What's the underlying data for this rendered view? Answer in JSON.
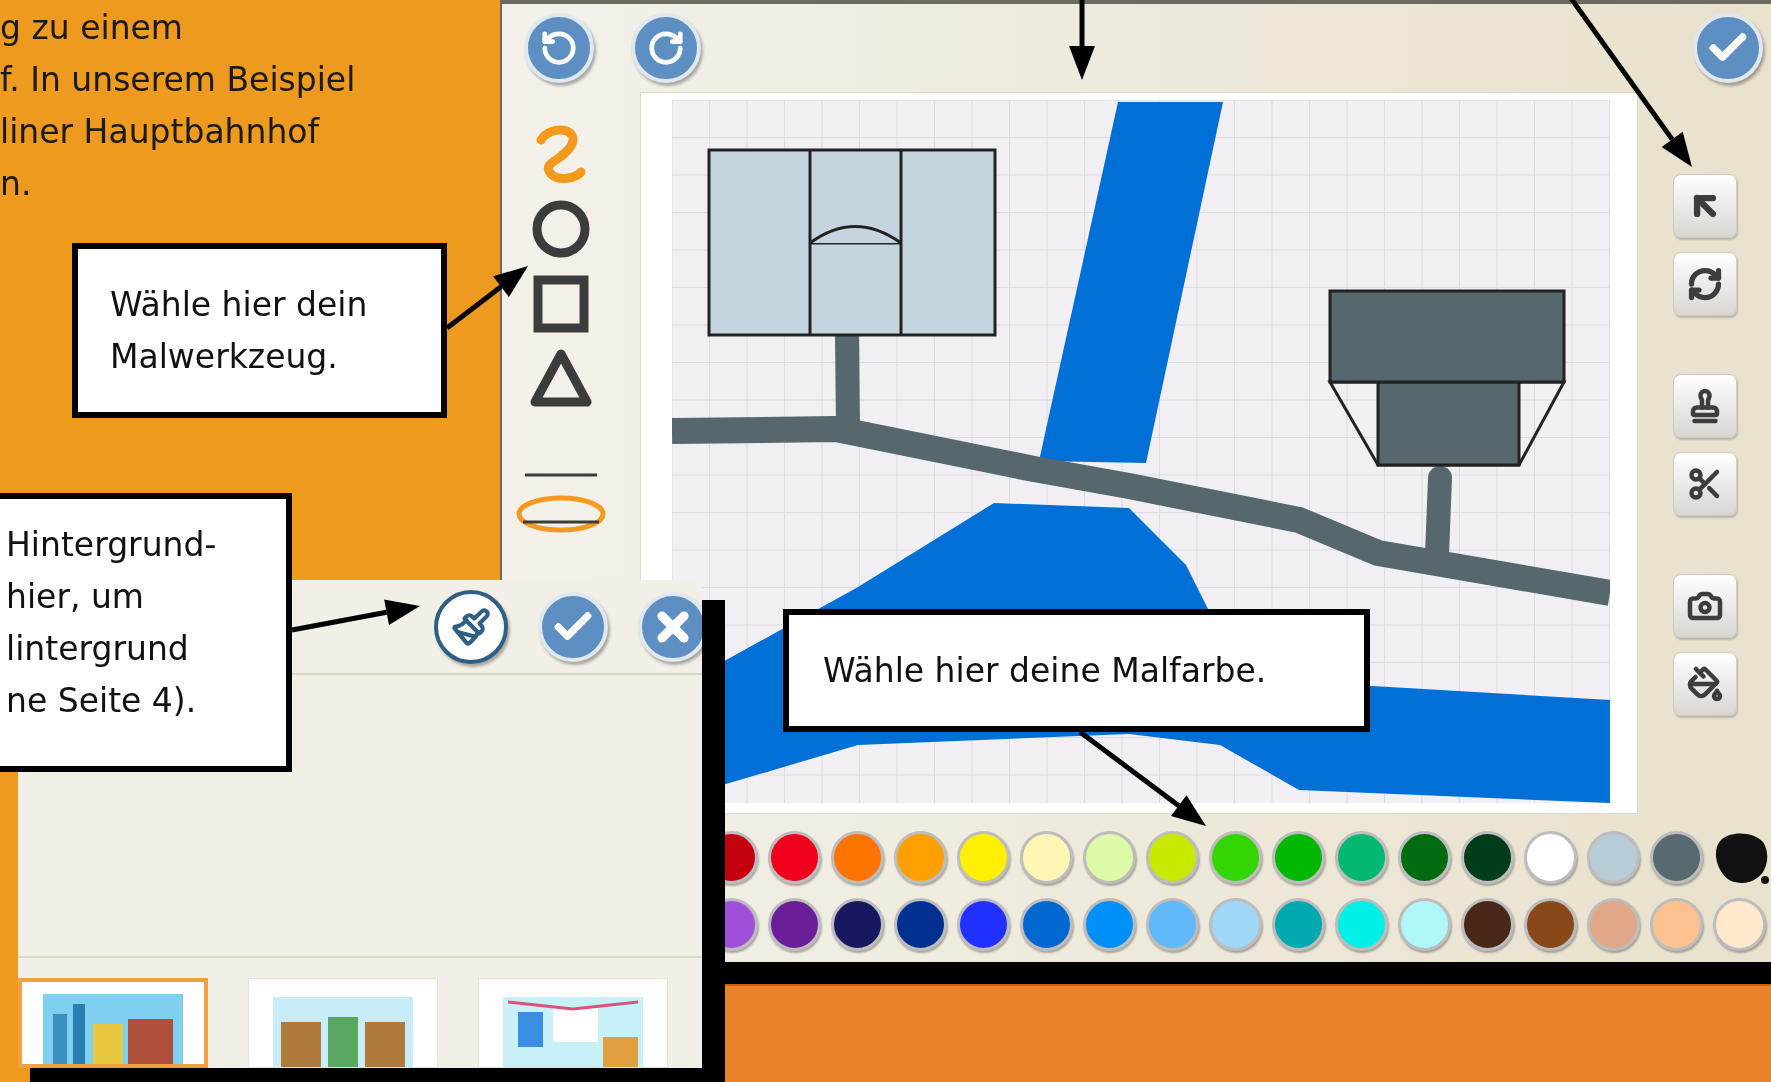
{
  "intro_text": {
    "lines": [
      "g zu einem",
      "f. In unserem Beispiel",
      "liner Hauptbahnhof",
      "n."
    ]
  },
  "callouts": [
    {
      "lines": [
        "Wähle hier dein",
        "Malwerkzeug."
      ]
    },
    {
      "lines": [
        "Hintergrund-",
        "hier, um",
        "lintergrund",
        "ne Seite 4)."
      ]
    },
    {
      "lines": [
        "Wähle hier deine Malfarbe."
      ]
    }
  ],
  "palette": {
    "rows": [
      [
        {
          "color": "#c4000e"
        },
        {
          "color": "#f0001c"
        },
        {
          "color": "#ff7400"
        },
        {
          "color": "#ffa000"
        },
        {
          "color": "#fff000"
        },
        {
          "color": "#fff5b5"
        },
        {
          "color": "#dcfaa8"
        },
        {
          "color": "#c8e800"
        },
        {
          "color": "#33d600"
        },
        {
          "color": "#00b800"
        },
        {
          "color": "#00b870"
        },
        {
          "color": "#006b10"
        },
        {
          "color": "#003d1a"
        },
        {
          "color": "#ffffff"
        },
        {
          "color": "#b8ccd8"
        },
        {
          "color": "#566a70"
        }
      ],
      [
        {
          "color": "#a050d8"
        },
        {
          "color": "#6a1e98"
        },
        {
          "color": "#181860"
        },
        {
          "color": "#003090"
        },
        {
          "color": "#2030ff"
        },
        {
          "color": "#0068d0"
        },
        {
          "color": "#0090f8"
        },
        {
          "color": "#60b8f8"
        },
        {
          "color": "#a0d8f8"
        },
        {
          "color": "#00a8b0"
        },
        {
          "color": "#00f0e8"
        },
        {
          "color": "#b0f8f8"
        },
        {
          "color": "#4a2818"
        },
        {
          "color": "#884818"
        },
        {
          "color": "#e0a888"
        },
        {
          "color": "#ffc090"
        },
        {
          "color": "#ffe8cc"
        }
      ]
    ]
  },
  "background_dialog": {
    "thumbnails": [
      {
        "kind": "city",
        "selected": true
      },
      {
        "kind": "library",
        "selected": false
      },
      {
        "kind": "classroom",
        "selected": false
      }
    ]
  }
}
